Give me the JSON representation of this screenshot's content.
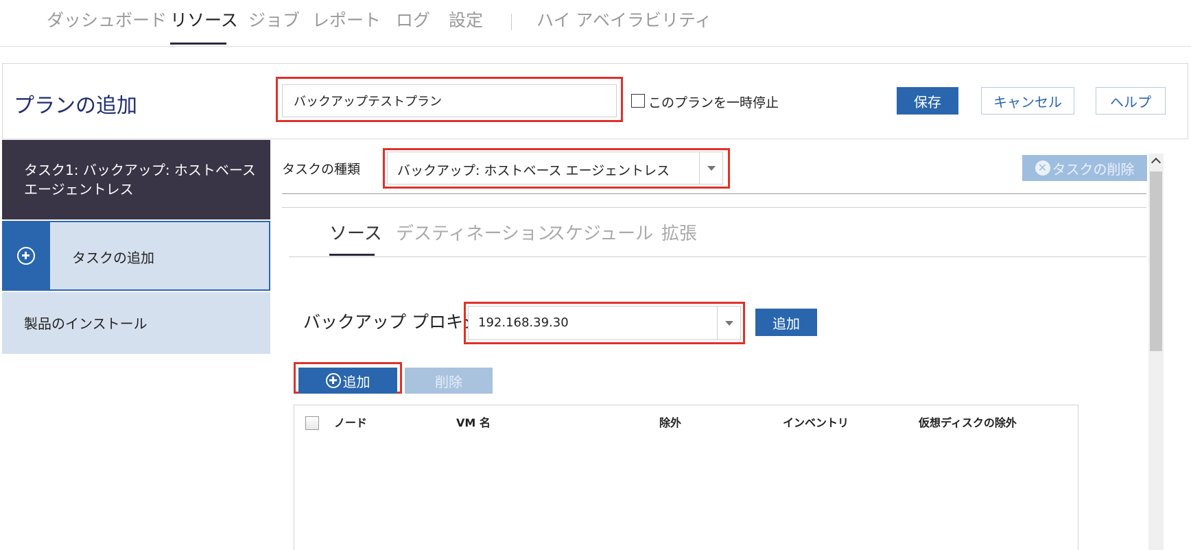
{
  "nav": {
    "items": [
      "ダッシュボード",
      "リソース",
      "ジョブ",
      "レポート",
      "ログ",
      "設定",
      "ハイ アベイラビリティ"
    ],
    "active": "リソース"
  },
  "plan": {
    "title": "プランの追加",
    "name_value": "バックアップテストプラン",
    "pause_label": "このプランを一時停止",
    "pause_checked": false,
    "save": "保存",
    "cancel": "キャンセル",
    "help": "ヘルプ"
  },
  "sidebar": {
    "task_label": "タスク1: バックアップ: ホストベース エージェントレス",
    "add_task": "タスクの追加",
    "install": "製品のインストール"
  },
  "task": {
    "type_label": "タスクの種類",
    "type_value": "バックアップ: ホストベース エージェントレス",
    "delete": "タスクの削除"
  },
  "tabs": [
    "ソース",
    "デスティネーション",
    "スケジュール",
    "拡張"
  ],
  "active_tab": "ソース",
  "source": {
    "proxy_label": "バックアップ プロキシ",
    "proxy_value": "192.168.39.30",
    "proxy_add": "追加",
    "add_button": "追加",
    "remove_button": "削除"
  },
  "table": {
    "columns": [
      "ノード",
      "VM 名",
      "除外",
      "インベントリ",
      "仮想ディスクの除外"
    ],
    "rows": []
  },
  "colors": {
    "primary": "#2a66ae",
    "highlight": "#e0302a",
    "sidebar_dark": "#3a3447",
    "sidebar_light": "#d5e0ef"
  }
}
